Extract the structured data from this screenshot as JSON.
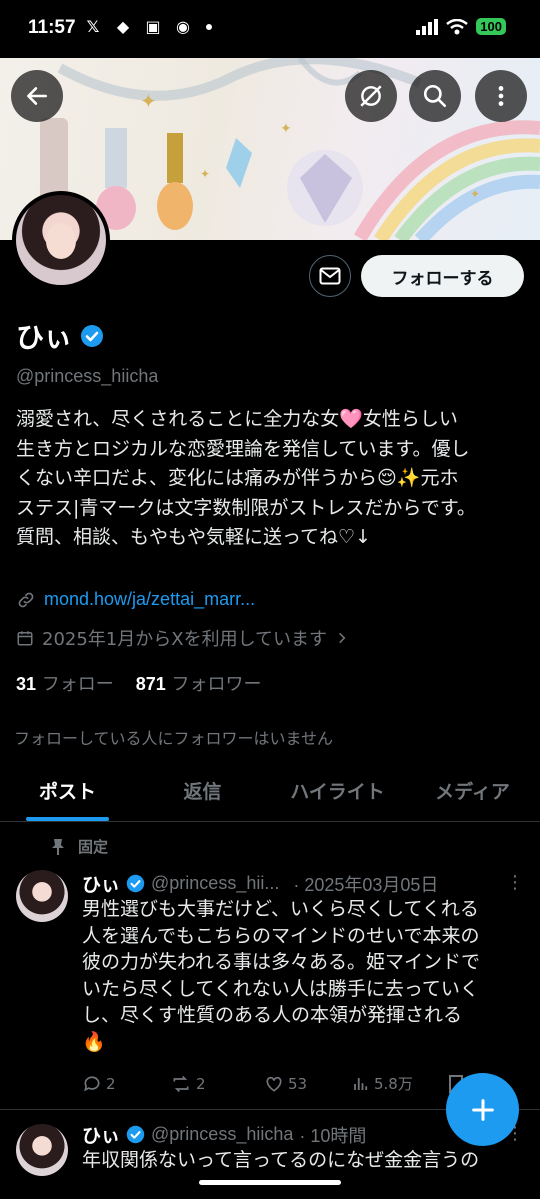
{
  "status_bar": {
    "time": "11:57",
    "battery": "100"
  },
  "profile": {
    "name": "ひぃ",
    "handle": "@princess_hiicha",
    "bio": "溺愛され、尽くされることに全力な女🩷女性らしい\n生き方とロジカルな恋愛理論を発信しています。優し\nくない辛口だよ、変化には痛みが伴うから😌✨元ホ\nステス|青マークは文字数制限がストレスだからです。\n質問、相談、もやもや気軽に送ってね♡↓",
    "link": "mond.how/ja/zettai_marr...",
    "joined": "2025年1月からXを利用しています",
    "following_count": "31",
    "following_label": "フォロー",
    "followers_count": "871",
    "followers_label": "フォロワー",
    "no_common_followers": "フォローしている人にフォロワーはいません"
  },
  "buttons": {
    "follow": "フォローする"
  },
  "tabs": [
    "ポスト",
    "返信",
    "ハイライト",
    "メディア"
  ],
  "pinned_label": "固定",
  "posts": [
    {
      "name": "ひぃ",
      "handle": "@princess_hii...",
      "time": "· 2025年03月05日",
      "text": "男性選びも大事だけど、いくら尽くしてくれる\n人を選んでもこちらのマインドのせいで本来の\n彼の力が失われる事は多々ある。姫マインドで\nいたら尽くしてくれない人は勝手に去っていく\nし、尽くす性質のある人の本領が発揮される\n🔥",
      "replies": "2",
      "reposts": "2",
      "likes": "53",
      "views": "5.8万"
    },
    {
      "name": "ひぃ",
      "handle": "@princess_hiicha",
      "time": "· 10時間",
      "text": "年収関係ないって言ってるのになぜ金金言うの"
    }
  ],
  "colors": {
    "accent": "#1d9bf0",
    "background": "#000000",
    "muted": "#71767b"
  }
}
